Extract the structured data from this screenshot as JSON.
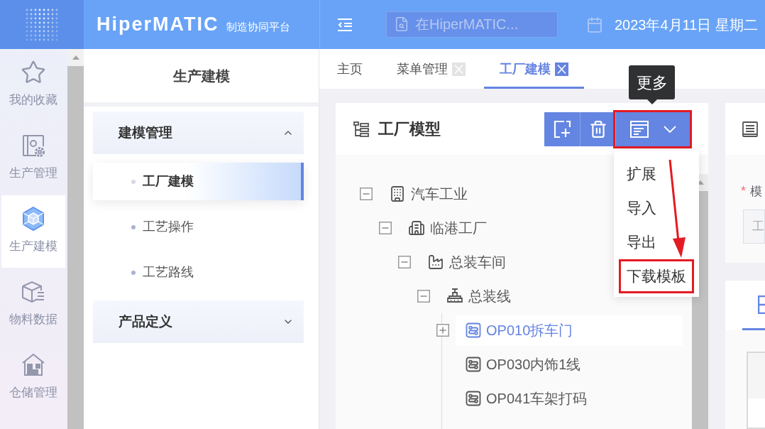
{
  "header": {
    "logo": {
      "wordmark": "HiperMATIC",
      "tagline": "制造协同平台"
    },
    "search": {
      "placeholder": "在HiperMATIC..."
    },
    "date": "2023年4月11日 星期二"
  },
  "nav_rail": {
    "items": [
      {
        "label": "我的收藏",
        "selected": false
      },
      {
        "label": "生产管理",
        "selected": false
      },
      {
        "label": "生产建模",
        "selected": true
      },
      {
        "label": "物料数据",
        "selected": false
      },
      {
        "label": "仓储管理",
        "selected": false
      }
    ]
  },
  "sidebar": {
    "title": "生产建模",
    "groups": [
      {
        "label": "建模管理",
        "expanded": true,
        "items": [
          {
            "label": "工厂建模",
            "selected": true
          },
          {
            "label": "工艺操作",
            "selected": false
          },
          {
            "label": "工艺路线",
            "selected": false
          }
        ]
      },
      {
        "label": "产品定义",
        "expanded": false
      }
    ]
  },
  "tabs": [
    {
      "label": "主页",
      "selected": false,
      "closable": false
    },
    {
      "label": "菜单管理",
      "selected": false,
      "closable": true
    },
    {
      "label": "工厂建模",
      "selected": true,
      "closable": true
    }
  ],
  "tree_panel": {
    "title": "工厂模型",
    "toolbar": [
      {
        "kind": "add",
        "highlighted": false
      },
      {
        "kind": "delete",
        "highlighted": false
      },
      {
        "kind": "more",
        "highlighted": true
      }
    ],
    "tooltip": "更多",
    "dropdown_menu": [
      {
        "label": "扩展",
        "highlighted": false
      },
      {
        "label": "导入",
        "highlighted": false
      },
      {
        "label": "导出",
        "highlighted": false
      },
      {
        "label": "下载模板",
        "highlighted": true
      }
    ],
    "tree": [
      {
        "label": "汽车工业",
        "kind": "enterprise",
        "expanded": true,
        "selected": false,
        "children": [
          {
            "label": "临港工厂",
            "kind": "factory",
            "expanded": true,
            "selected": false,
            "children": [
              {
                "label": "总装车间",
                "kind": "workshop",
                "expanded": true,
                "selected": false,
                "children": [
                  {
                    "label": "总装线",
                    "kind": "line",
                    "expanded": true,
                    "selected": false,
                    "children": [
                      {
                        "label": "OP010拆车门",
                        "kind": "operation",
                        "expanded": false,
                        "selected": true
                      },
                      {
                        "label": "OP030内饰1线",
                        "kind": "operation",
                        "selected": false
                      },
                      {
                        "label": "OP041车架打码",
                        "kind": "operation",
                        "selected": false
                      }
                    ]
                  }
                ]
              }
            ]
          }
        ]
      }
    ]
  },
  "detail_panel": {
    "field": {
      "required_mark": "*",
      "label": "模",
      "value": "工"
    }
  }
}
